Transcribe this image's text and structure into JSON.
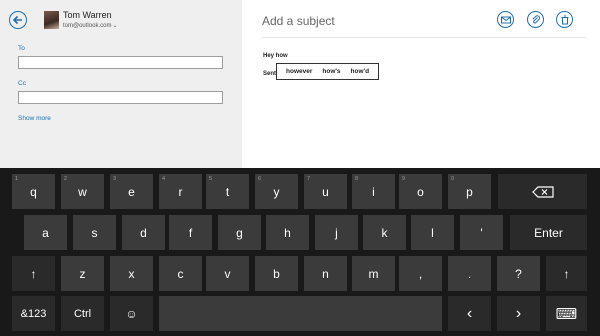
{
  "sender": {
    "name": "Tom Warren",
    "email": "tom@outlook.com"
  },
  "fields": {
    "to_label": "To",
    "cc_label": "Cc",
    "show_more": "Show more"
  },
  "compose": {
    "subject_placeholder": "Add a subject",
    "body_line1": "Hey how",
    "body_line2": "Sent"
  },
  "suggestions": [
    "however",
    "how's",
    "how'd"
  ],
  "toolbar_icons": [
    "email-icon",
    "attach-icon",
    "delete-icon"
  ],
  "keyboard": {
    "row1": [
      {
        "label": "q",
        "hint": "1"
      },
      {
        "label": "w",
        "hint": "2"
      },
      {
        "label": "e",
        "hint": "3"
      },
      {
        "label": "r",
        "hint": "4"
      },
      {
        "label": "t",
        "hint": "5"
      },
      {
        "label": "y",
        "hint": "6"
      },
      {
        "label": "u",
        "hint": "7"
      },
      {
        "label": "i",
        "hint": "8"
      },
      {
        "label": "o",
        "hint": "9"
      },
      {
        "label": "p",
        "hint": "0"
      }
    ],
    "row2": [
      "a",
      "s",
      "d",
      "f",
      "g",
      "h",
      "j",
      "k",
      "l",
      "'"
    ],
    "row2_enter": "Enter",
    "row3": [
      "z",
      "x",
      "c",
      "v",
      "b",
      "n",
      "m",
      ",",
      ".",
      "?"
    ],
    "row4_symbols": "&123",
    "row4_ctrl": "Ctrl",
    "arrow_left": "‹",
    "arrow_right": "›",
    "shift": "↑",
    "emoji": "☺",
    "backspace": "⌫",
    "keyboard_switch": "⌨"
  }
}
